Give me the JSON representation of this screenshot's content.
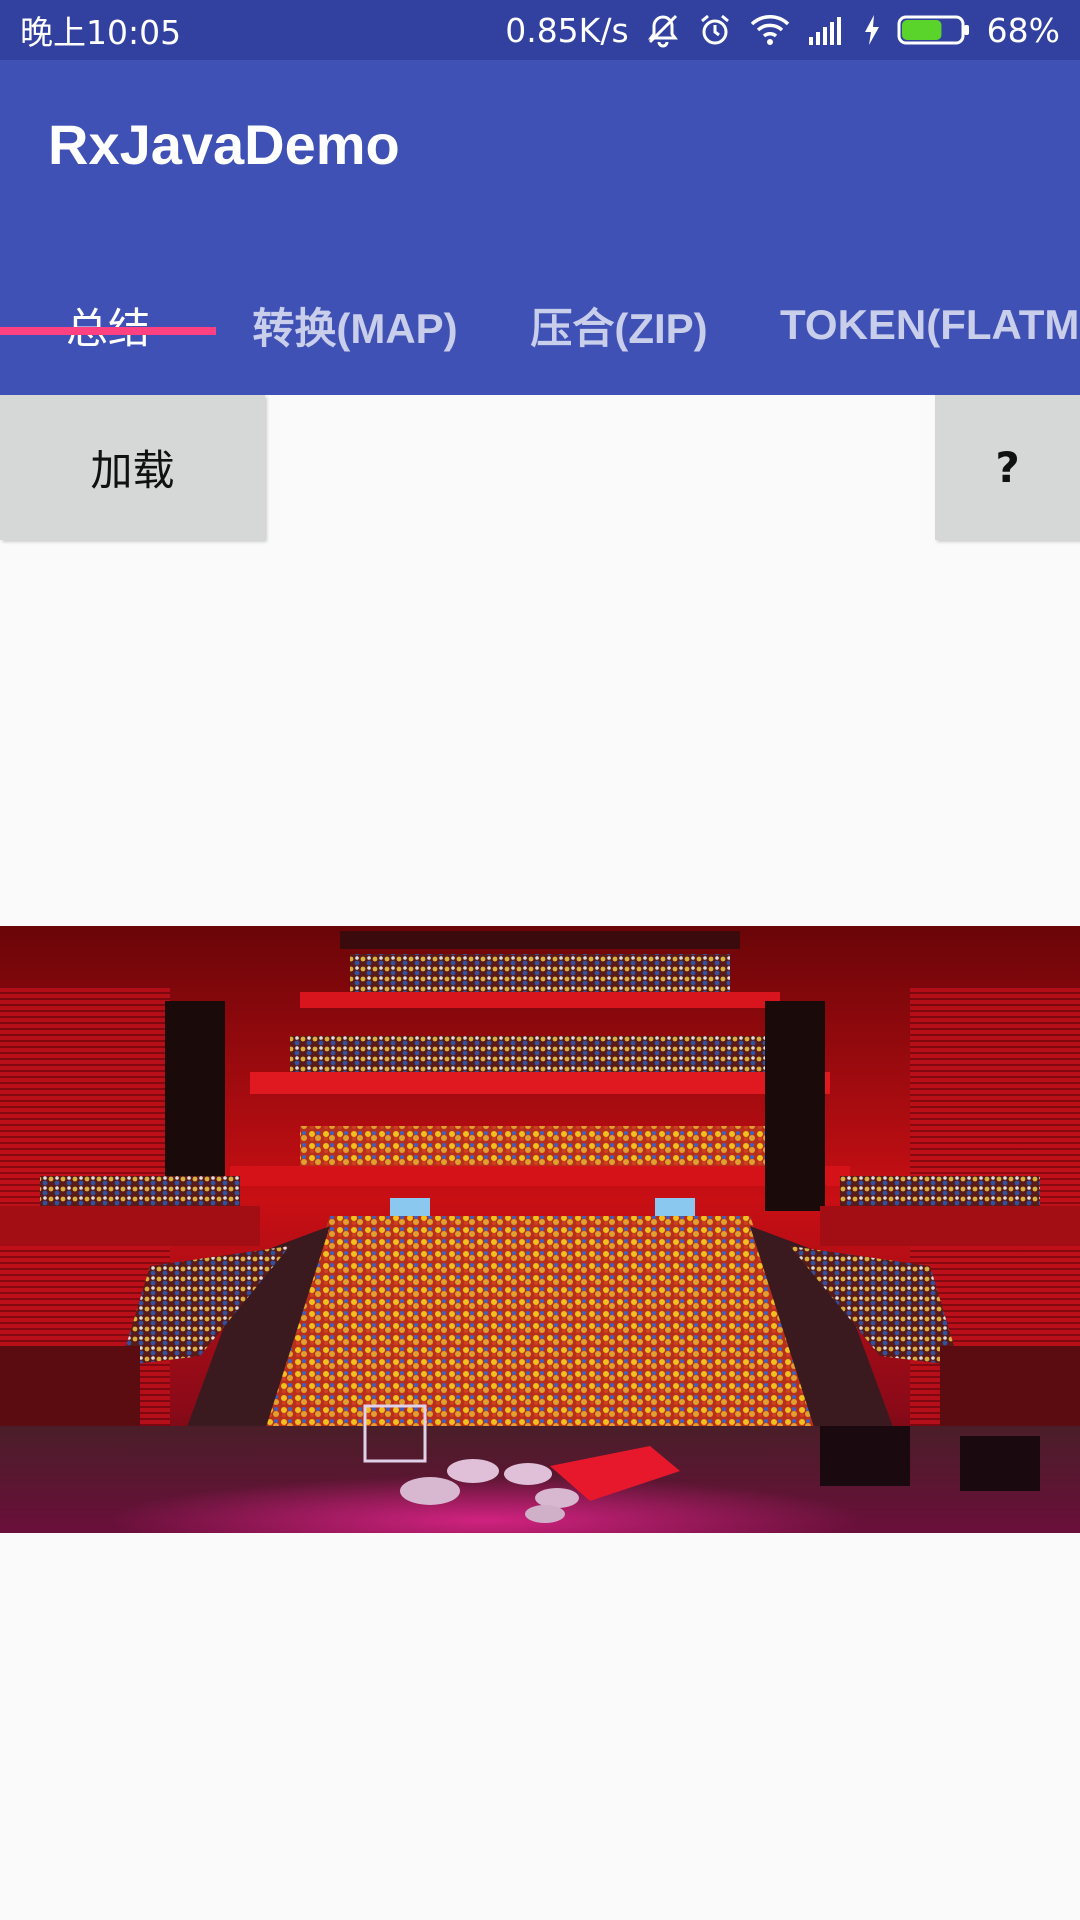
{
  "status_bar": {
    "time": "晚上10:05",
    "net_speed": "0.85K/s",
    "battery_percent": "68%",
    "battery_level": 0.68,
    "icons": [
      "mute-vibrate-icon",
      "alarm-icon",
      "wifi-icon",
      "signal-icon",
      "charging-icon",
      "battery-icon"
    ]
  },
  "app_bar": {
    "title": "RxJavaDemo",
    "color": "#3f51b5",
    "status_color": "#3240a0"
  },
  "tabs": [
    {
      "label": "总结",
      "active": true
    },
    {
      "label": "转换(MAP)",
      "active": false
    },
    {
      "label": "压合(ZIP)",
      "active": false
    },
    {
      "label": "TOKEN(FLATMAP)",
      "active": false
    }
  ],
  "tab_indicator_color": "#ff4081",
  "buttons": {
    "load_label": "加载",
    "help_label": "?"
  },
  "image": {
    "icon": "concert-hall-photo"
  }
}
